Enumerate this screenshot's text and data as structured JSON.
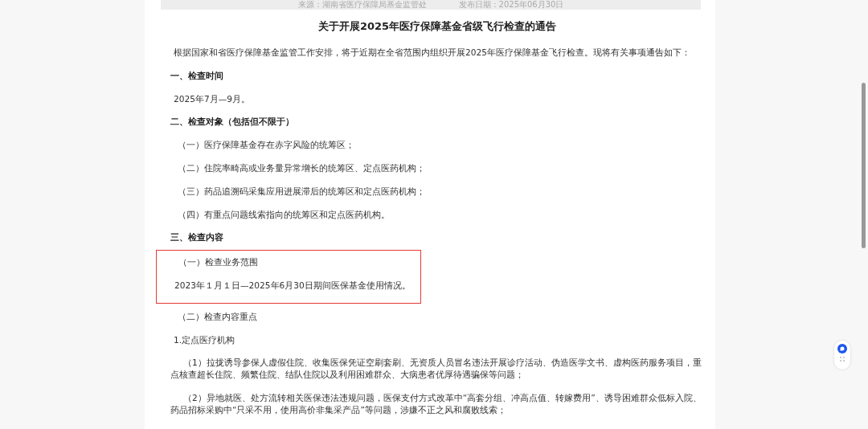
{
  "meta_bar": {
    "source": "来源：湖南省医疗保障局基金监管处",
    "date": "发布日期：2025年06月30日"
  },
  "title": "关于开展2025年医疗保障基金省级飞行检查的通告",
  "blocks": [
    {
      "kind": "para",
      "text": "根据国家和省医疗保障基金监管工作安排，将于近期在全省范围内组织开展2025年医疗保障基金飞行检查。现将有关事项通告如下："
    },
    {
      "kind": "heading",
      "text": "一、检查时间"
    },
    {
      "kind": "para",
      "text": "2025年7月—9月。"
    },
    {
      "kind": "heading",
      "text": "二、检查对象（包括但不限于）"
    },
    {
      "kind": "item",
      "text": "（一）医疗保障基金存在赤字风险的统筹区；"
    },
    {
      "kind": "item",
      "text": "（二）住院率畸高或业务量异常增长的统筹区、定点医药机构；"
    },
    {
      "kind": "item",
      "text": "（三）药品追溯码采集应用进展滞后的统筹区和定点医药机构；"
    },
    {
      "kind": "item",
      "text": "（四）有重点问题线索指向的统筹区和定点医药机构。"
    },
    {
      "kind": "heading",
      "text": "三、检查内容"
    },
    {
      "kind": "boxed",
      "children": [
        {
          "kind": "item",
          "text": "（一）检查业务范围"
        },
        {
          "kind": "para",
          "text": "2023年１月１日—2025年6月30日期间医保基金使用情况。"
        }
      ]
    },
    {
      "kind": "item",
      "text": "（二）检查内容重点"
    },
    {
      "kind": "para",
      "text": "1.定点医疗机构"
    },
    {
      "kind": "sub",
      "text": "（1）拉拢诱导参保人虚假住院、收集医保凭证空刷套刷、无资质人员冒名违法开展诊疗活动、伪造医学文书、虚构医药服务项目，重点核查超长住院、频繁住院、结队住院以及利用困难群众、大病患者优厚待遇骗保等问题；"
    },
    {
      "kind": "sub",
      "text": "（2）异地就医、处方流转相关医保违法违规问题，医保支付方式改革中“高套分组、冲高点值、转嫁费用”、诱导困难群众低标入院、药品招标采购中“只采不用，使用高价非集采产品”等问题，涉嫌不正之风和腐败线索；"
    }
  ]
}
